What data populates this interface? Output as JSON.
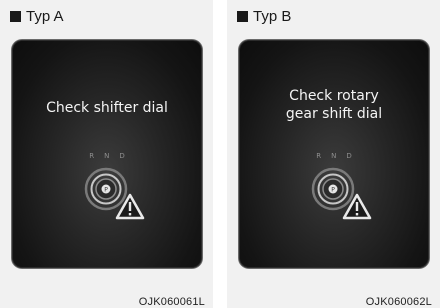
{
  "panels": [
    {
      "header": "Typ A",
      "message_lines": [
        "Check shifter dial"
      ],
      "gears": [
        "R",
        "N",
        "D"
      ],
      "dial_label": "P",
      "code": "OJK060061L"
    },
    {
      "header": "Typ B",
      "message_lines": [
        "Check rotary",
        "gear shift dial"
      ],
      "gears": [
        "R",
        "N",
        "D"
      ],
      "dial_label": "P",
      "code": "OJK060062L"
    }
  ],
  "icons": {
    "header_marker": "black-square-icon",
    "dial": "rotary-shifter-dial-icon",
    "warning": "warning-triangle-icon"
  },
  "colors": {
    "screen_bg": "#141414",
    "text": "#f4f4f4",
    "panel_bg": "#f1f1f1"
  }
}
